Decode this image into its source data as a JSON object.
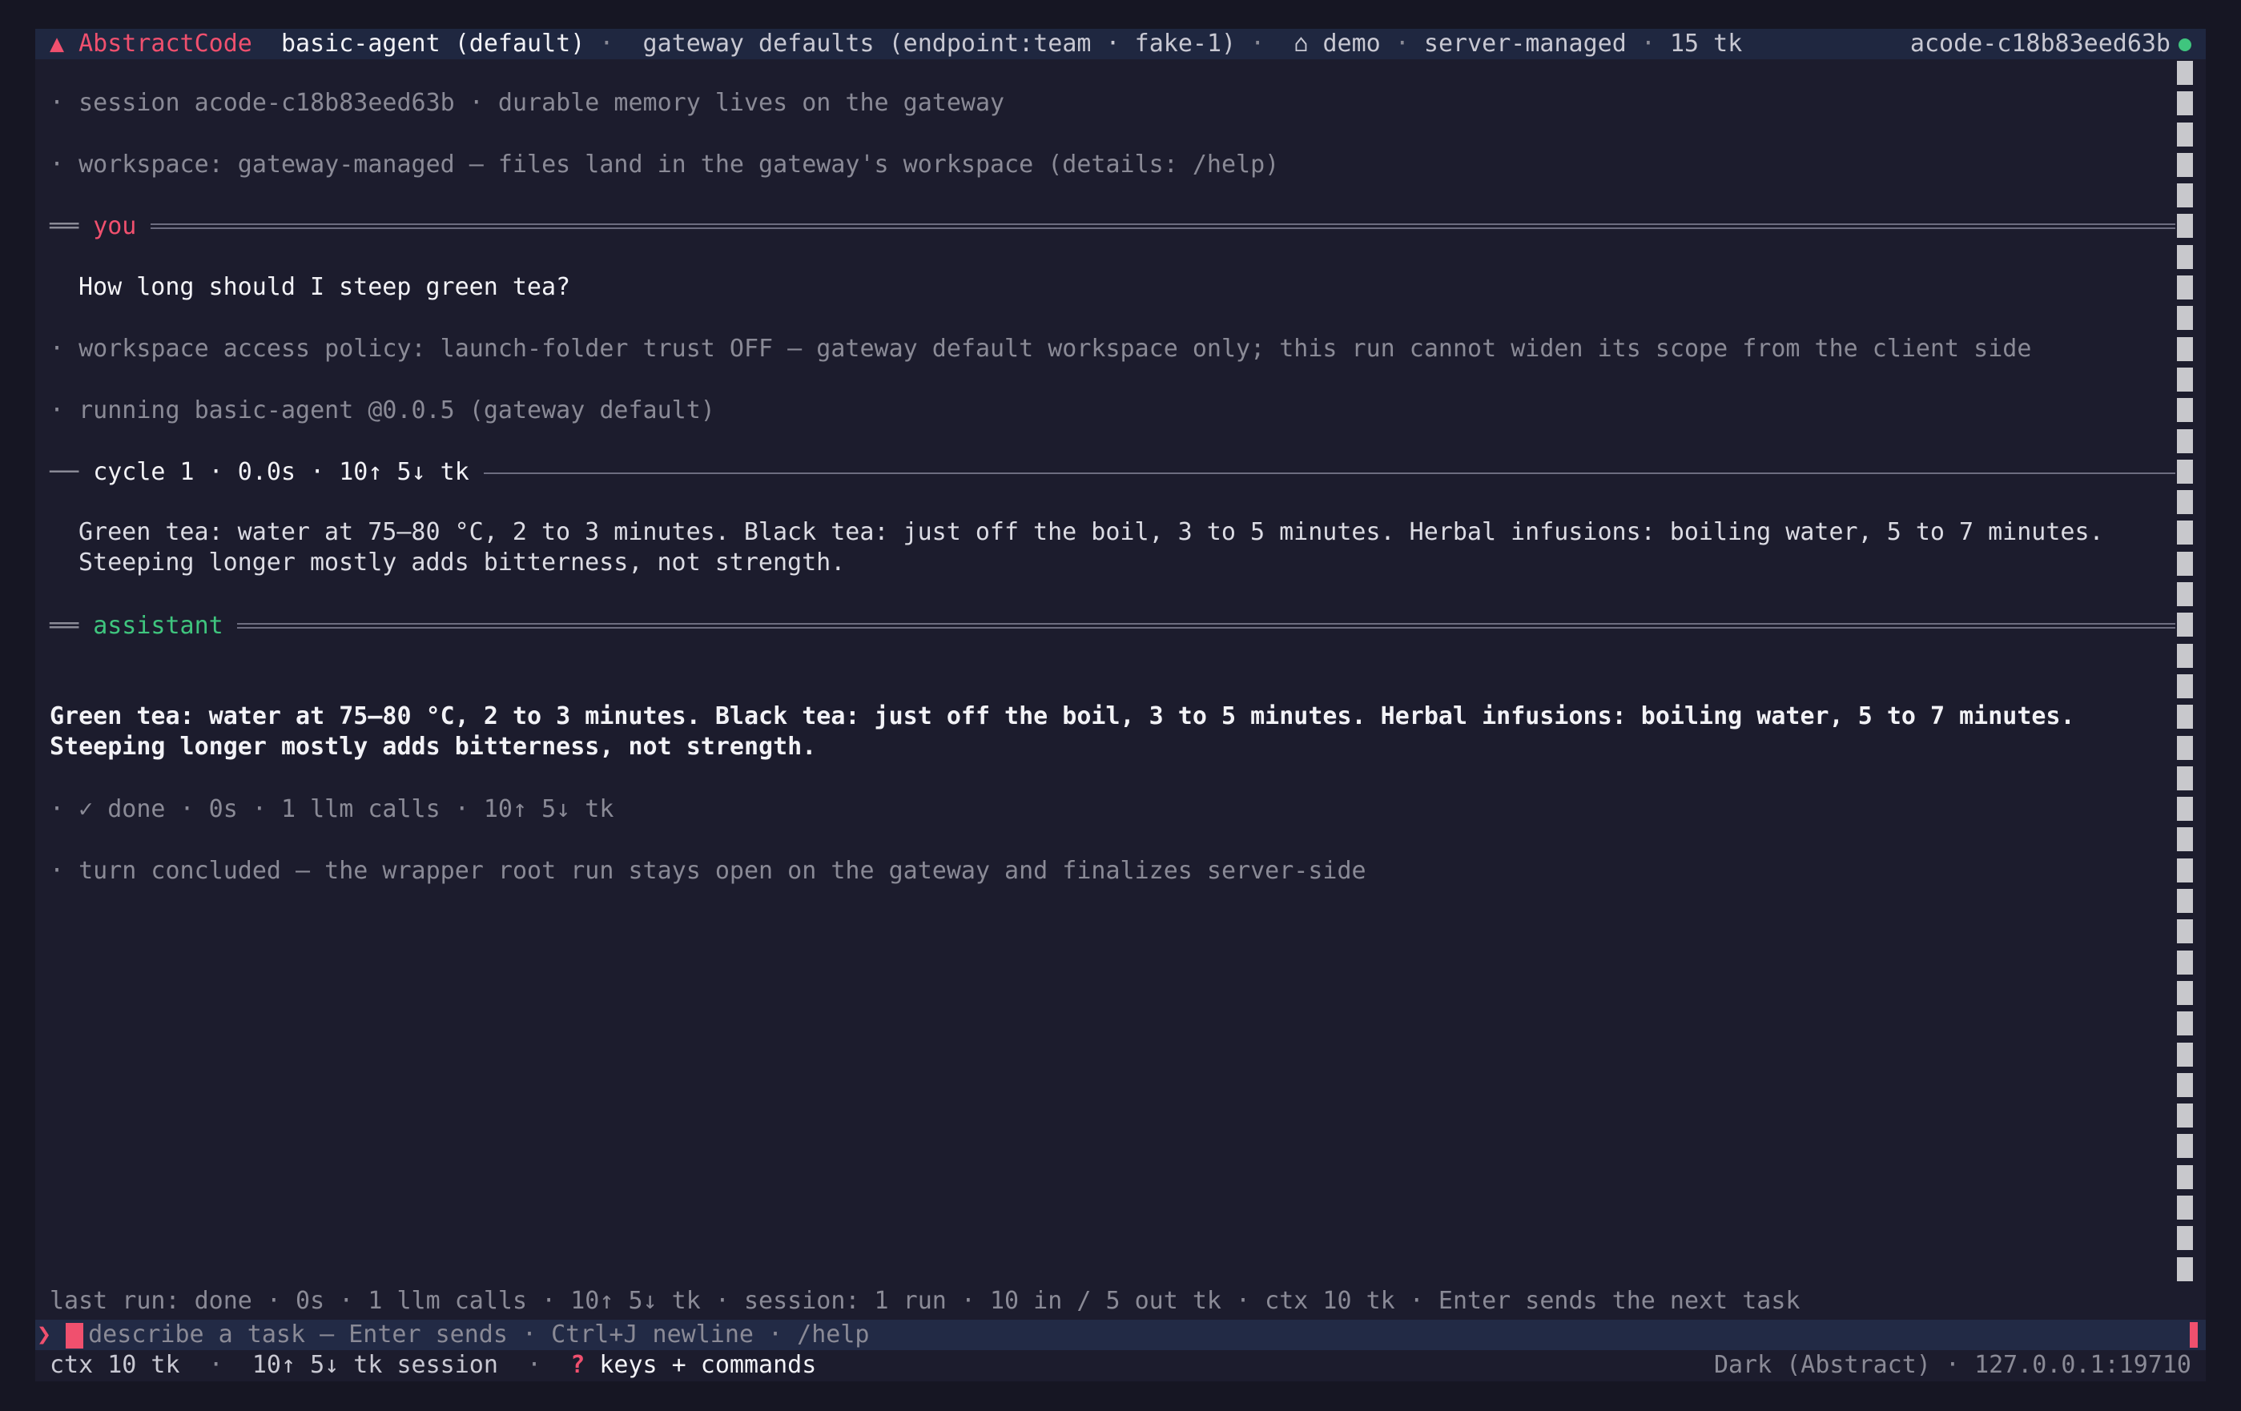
{
  "topbar": {
    "app_glyph": "▲",
    "app_name": "AbstractCode",
    "agent": "basic-agent (default)",
    "sep1": " · ",
    "gateway": "gateway defaults (endpoint:team · fake-1)",
    "sep2": " · ",
    "home_icon": "⌂",
    "workspace": "demo",
    "sep3": " · ",
    "mode": "server-managed",
    "sep4": " · ",
    "tokens": "15 tk",
    "session_id": "acode-c18b83eed63b",
    "status_color": "#3fc57e"
  },
  "transcript": {
    "session_note": "· session acode-c18b83eed63b · durable memory lives on the gateway",
    "workspace_note": "· workspace: gateway-managed — files land in the gateway's workspace (details: /help)",
    "you_prefix": "══",
    "you_label": "you",
    "user_message": "How long should I steep green tea?",
    "policy_note": "· workspace access policy: launch-folder trust OFF — gateway default workspace only; this run cannot widen its scope from the client side",
    "running_note": "· running basic-agent @0.0.5 (gateway default)",
    "cycle_prefix": "──",
    "cycle_label": "cycle 1 · 0.0s · 10↑ 5↓ tk",
    "cycle_output_1": "Green tea: water at 75–80 °C, 2 to 3 minutes. Black tea: just off the boil, 3 to 5 minutes. Herbal infusions: boiling water, 5 to 7 minutes.",
    "cycle_output_2": "Steeping longer mostly adds bitterness, not strength.",
    "assistant_prefix": "══",
    "assistant_label": "assistant",
    "answer_1": "Green tea: water at 75–80 °C, 2 to 3 minutes. Black tea: just off the boil, 3 to 5 minutes. Herbal infusions: boiling water, 5 to 7 minutes.",
    "answer_2": "Steeping longer mostly adds bitterness, not strength.",
    "done_note": "· ✓ done · 0s · 1 llm calls · 10↑ 5↓ tk",
    "turn_note": "· turn concluded — the wrapper root run stays open on the gateway and finalizes server-side"
  },
  "footer": {
    "last_run": "last run: done · 0s · 1 llm calls · 10↑ 5↓ tk · session: 1 run · 10 in / 5 out tk · ctx 10 tk · Enter sends the next task",
    "prompt_glyph": "❯",
    "input_placeholder": "describe a task — Enter sends · Ctrl+J newline · /help",
    "ctx": "ctx 10 tk",
    "sep1": "  ·  ",
    "session_tokens": "10↑ 5↓ tk session",
    "sep2": "  ·  ",
    "help_key": "?",
    "help_label": " keys + commands",
    "theme": "Dark (Abstract)",
    "sep3": " · ",
    "address": "127.0.0.1:19710",
    "accent_color": "#f0506e"
  }
}
